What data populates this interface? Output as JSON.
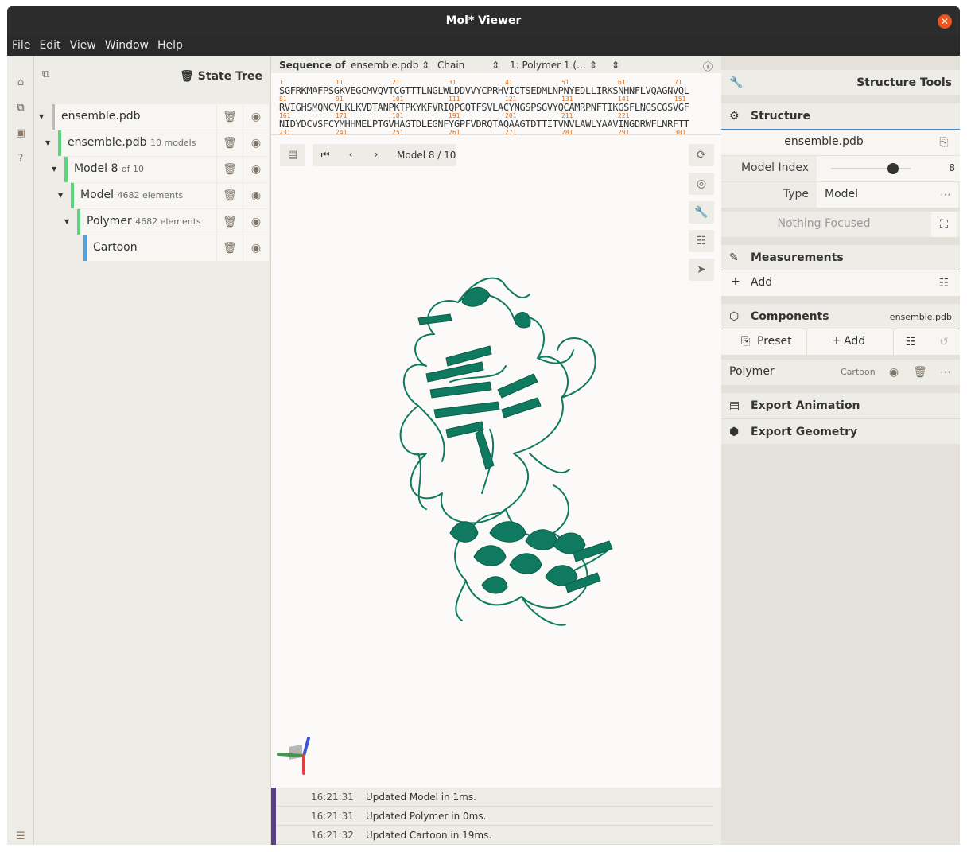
{
  "window": {
    "title": "Mol* Viewer"
  },
  "menu": [
    "File",
    "Edit",
    "View",
    "Window",
    "Help"
  ],
  "state_tree": {
    "title": "State Tree",
    "rows": [
      {
        "label": "ensemble.pdb",
        "sub": ""
      },
      {
        "label": "ensemble.pdb",
        "sub": "10 models"
      },
      {
        "label": "Model 8",
        "sub": "of 10"
      },
      {
        "label": "Model",
        "sub": "4682 elements"
      },
      {
        "label": "Polymer",
        "sub": "4682 elements"
      },
      {
        "label": "Cartoon",
        "sub": ""
      }
    ]
  },
  "sequence": {
    "label": "Sequence of",
    "structure": "ensemble.pdb",
    "mode": "Chain",
    "entity": "1: Polymer 1 (…",
    "lines": [
      "SGFRKMAFPSGKVEGCMVQVTCGTTTLNGLWLDDVVYCPRHVICTSEDMLNPNYEDLLIRKSNHNFLVQAGNVQL",
      "RVIGHSMQNCVLKLKVDTANPKTPKYKFVRIQPGQTFSVLACYNGSPSGVYQCAMRPNFTIKGSFLNGSCGSVGF",
      "NIDYDCVSFCYMHHMELPTGVHAGTDLEGNFYGPFVDRQTAQAAGTDTTITVNVLAWLYAAVINGDRWFLNRFTT"
    ],
    "numbers_1": [
      "1",
      "11",
      "21",
      "31",
      "41",
      "51",
      "61",
      "71"
    ],
    "numbers_2": [
      "81",
      "91",
      "101",
      "111",
      "121",
      "131",
      "141",
      "151"
    ],
    "numbers_3": [
      "161",
      "171",
      "181",
      "191",
      "201",
      "211",
      "221"
    ],
    "numbers_4": [
      "231",
      "241",
      "251",
      "261",
      "271",
      "281",
      "291",
      "301"
    ]
  },
  "model_controls": {
    "label": "Model 8 / 10"
  },
  "log": [
    {
      "time": "16:21:31",
      "msg": "Updated Model in 1ms."
    },
    {
      "time": "16:21:31",
      "msg": "Updated Polymer in 0ms."
    },
    {
      "time": "16:21:32",
      "msg": "Updated Cartoon in 19ms."
    }
  ],
  "structure_tools": {
    "title": "Structure Tools",
    "structure_section": "Structure",
    "structure_name": "ensemble.pdb",
    "model_index_label": "Model Index",
    "model_index_value": "8",
    "model_index_fraction": 0.78,
    "type_label": "Type",
    "type_value": "Model",
    "focus_text": "Nothing Focused",
    "measurements": "Measurements",
    "add_label": "Add",
    "components": "Components",
    "components_source": "ensemble.pdb",
    "preset_label": "Preset",
    "add_component_label": "Add",
    "component_name": "Polymer",
    "component_repr": "Cartoon",
    "export_animation": "Export Animation",
    "export_geometry": "Export Geometry"
  },
  "colors": {
    "protein": "#0f7a5f",
    "accent": "#4b8cc5",
    "tree_green": "#5ed37d",
    "tree_blue": "#4da3e0"
  }
}
